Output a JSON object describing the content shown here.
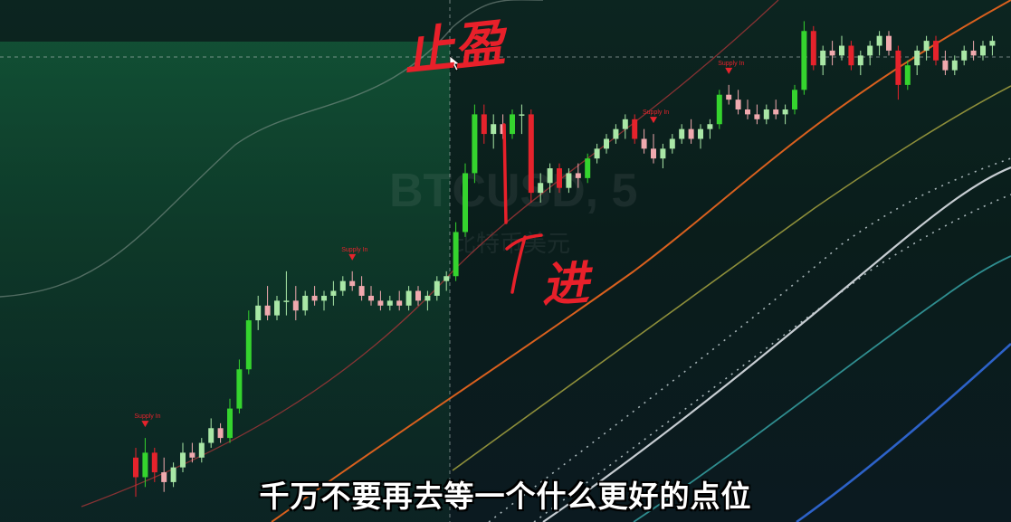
{
  "watermark": {
    "symbol": "BTCUSD",
    "interval": "5",
    "name": "比特币美元"
  },
  "annotations": {
    "take_profit": "止盈",
    "entry": "进"
  },
  "subtitle": "千万不要再去等一个什么更好的点位",
  "signal_label": "Supply In",
  "colors": {
    "up": "#35d42e",
    "up_light": "#a9e7a6",
    "down": "#e5232c",
    "down_light": "#f0a9ae",
    "zone": "#145c3a",
    "annotation": "#e8202a",
    "signal": "#e5232c"
  },
  "chart_data": {
    "type": "candlestick",
    "symbol": "BTCUSD",
    "interval": "5",
    "ylim": [
      0,
      100
    ],
    "candles": [
      [
        0,
        10,
        12,
        2,
        6
      ],
      [
        1,
        6,
        14,
        4,
        11
      ],
      [
        2,
        11,
        12,
        5,
        7
      ],
      [
        3,
        7,
        10,
        3,
        5
      ],
      [
        4,
        5,
        9,
        4,
        8
      ],
      [
        5,
        8,
        13,
        7,
        11
      ],
      [
        6,
        11,
        13,
        9,
        10
      ],
      [
        7,
        10,
        14,
        9,
        13
      ],
      [
        8,
        13,
        18,
        12,
        16
      ],
      [
        9,
        16,
        17,
        13,
        14
      ],
      [
        10,
        14,
        22,
        13,
        20
      ],
      [
        11,
        20,
        30,
        19,
        28
      ],
      [
        12,
        28,
        40,
        27,
        38
      ],
      [
        13,
        38,
        43,
        36,
        41
      ],
      [
        14,
        41,
        45,
        38,
        39
      ],
      [
        15,
        39,
        43,
        38,
        42
      ],
      [
        16,
        42,
        48,
        39,
        42
      ],
      [
        17,
        42,
        45,
        38,
        40
      ],
      [
        18,
        40,
        44,
        39,
        43
      ],
      [
        19,
        43,
        45,
        41,
        42
      ],
      [
        20,
        42,
        44,
        40,
        43
      ],
      [
        21,
        43,
        46,
        41,
        44
      ],
      [
        22,
        44,
        47,
        43,
        46
      ],
      [
        23,
        46,
        48,
        44,
        45
      ],
      [
        24,
        45,
        47,
        42,
        43
      ],
      [
        25,
        43,
        45,
        41,
        42
      ],
      [
        26,
        42,
        44,
        40,
        41
      ],
      [
        27,
        41,
        43,
        40,
        42
      ],
      [
        28,
        42,
        44,
        40,
        41
      ],
      [
        29,
        41,
        45,
        40,
        44
      ],
      [
        30,
        44,
        45,
        41,
        42
      ],
      [
        31,
        42,
        44,
        40,
        43
      ],
      [
        32,
        43,
        47,
        42,
        46
      ],
      [
        33,
        46,
        48,
        44,
        47
      ],
      [
        34,
        47,
        58,
        46,
        56
      ],
      [
        35,
        56,
        70,
        55,
        68
      ],
      [
        36,
        68,
        82,
        66,
        80
      ],
      [
        37,
        80,
        82,
        74,
        76
      ],
      [
        38,
        76,
        80,
        73,
        78
      ],
      [
        39,
        78,
        80,
        75,
        76
      ],
      [
        40,
        76,
        81,
        75,
        80
      ],
      [
        41,
        80,
        82,
        76,
        80
      ],
      [
        42,
        80,
        81,
        62,
        64
      ],
      [
        43,
        64,
        68,
        62,
        66
      ],
      [
        44,
        66,
        70,
        64,
        69
      ],
      [
        45,
        69,
        70,
        64,
        65
      ],
      [
        46,
        65,
        69,
        64,
        68
      ],
      [
        47,
        68,
        70,
        65,
        67
      ],
      [
        48,
        67,
        72,
        66,
        71
      ],
      [
        49,
        71,
        74,
        70,
        73
      ],
      [
        50,
        73,
        76,
        72,
        75
      ],
      [
        51,
        75,
        78,
        74,
        77
      ],
      [
        52,
        77,
        80,
        75,
        79
      ],
      [
        53,
        79,
        80,
        74,
        75
      ],
      [
        54,
        75,
        77,
        72,
        73
      ],
      [
        55,
        73,
        76,
        70,
        71
      ],
      [
        56,
        71,
        74,
        69,
        73
      ],
      [
        57,
        73,
        76,
        72,
        75
      ],
      [
        58,
        75,
        78,
        74,
        77
      ],
      [
        59,
        77,
        79,
        74,
        75
      ],
      [
        60,
        75,
        78,
        73,
        77
      ],
      [
        61,
        77,
        79,
        75,
        78
      ],
      [
        62,
        78,
        85,
        77,
        84
      ],
      [
        63,
        84,
        86,
        82,
        83
      ],
      [
        64,
        83,
        85,
        80,
        81
      ],
      [
        65,
        81,
        83,
        79,
        80
      ],
      [
        66,
        80,
        82,
        78,
        79
      ],
      [
        67,
        79,
        82,
        78,
        81
      ],
      [
        68,
        81,
        83,
        79,
        80
      ],
      [
        69,
        80,
        82,
        78,
        81
      ],
      [
        70,
        81,
        86,
        80,
        85
      ],
      [
        71,
        85,
        99,
        84,
        97
      ],
      [
        72,
        97,
        98,
        89,
        90
      ],
      [
        73,
        90,
        94,
        88,
        93
      ],
      [
        74,
        93,
        95,
        90,
        92
      ],
      [
        75,
        92,
        96,
        91,
        94
      ],
      [
        76,
        94,
        95,
        89,
        90
      ],
      [
        77,
        90,
        93,
        88,
        92
      ],
      [
        78,
        92,
        95,
        90,
        94
      ],
      [
        79,
        94,
        97,
        92,
        96
      ],
      [
        80,
        96,
        97,
        92,
        93
      ],
      [
        81,
        93,
        94,
        83,
        86
      ],
      [
        82,
        86,
        91,
        85,
        90
      ],
      [
        83,
        90,
        94,
        88,
        93
      ],
      [
        84,
        93,
        96,
        91,
        95
      ],
      [
        85,
        95,
        96,
        90,
        91
      ],
      [
        86,
        91,
        93,
        88,
        89
      ],
      [
        87,
        89,
        92,
        88,
        91
      ],
      [
        88,
        91,
        94,
        90,
        93
      ],
      [
        89,
        93,
        95,
        91,
        92
      ],
      [
        90,
        92,
        95,
        91,
        94
      ],
      [
        91,
        94,
        96,
        92,
        95
      ]
    ],
    "signals": [
      {
        "label": "Supply In",
        "x": 1
      },
      {
        "label": "Supply In",
        "x": 23
      },
      {
        "label": "Supply In",
        "x": 55
      },
      {
        "label": "Supply In",
        "x": 63
      }
    ],
    "entry_x": 42,
    "take_profit_x": 34
  }
}
